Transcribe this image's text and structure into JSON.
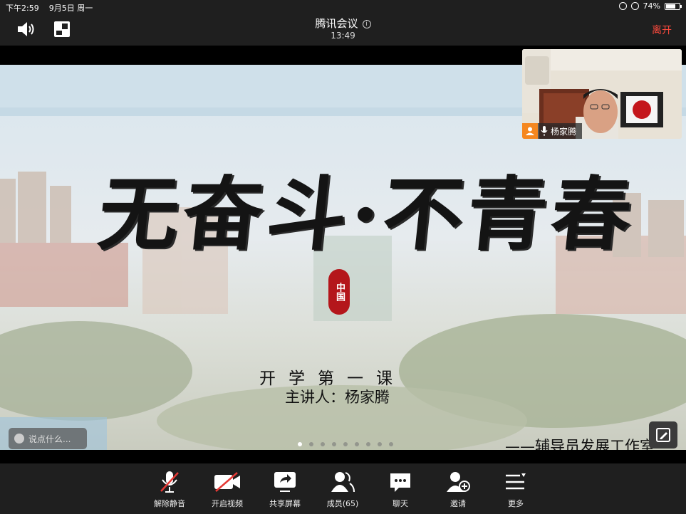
{
  "status_bar": {
    "time": "下午2:59",
    "date": "9月5日 周一",
    "battery": "74%",
    "battery_level": 0.74
  },
  "header": {
    "title": "腾讯会议",
    "timer": "13:49",
    "leave_label": "离开"
  },
  "shared_slide": {
    "headline": "无奋斗·不青春",
    "seal_text": "中国",
    "course_title": "开学第一课",
    "lecturer": "主讲人：杨家腾",
    "studio": "——辅导员发展工作室",
    "page_count": 9,
    "current_page": 1
  },
  "chat_input": {
    "placeholder": "说点什么..."
  },
  "video_tile": {
    "participant_name": "杨家腾",
    "badge_color": "#f5871f"
  },
  "toolbar": {
    "unmute": "解除静音",
    "start_video": "开启视频",
    "share_screen": "共享屏幕",
    "members": "成员(65)",
    "chat": "聊天",
    "invite": "邀请",
    "more": "更多"
  },
  "colors": {
    "leave": "#ff4a3d",
    "muted_slash": "#e53935",
    "seal": "#b4161b"
  }
}
